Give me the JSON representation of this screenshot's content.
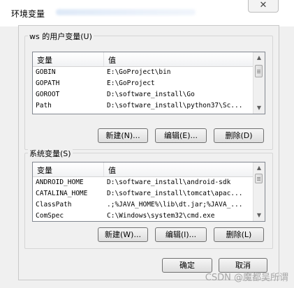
{
  "window": {
    "title": "环境变量",
    "close_label": "✕"
  },
  "user_vars": {
    "label": "ws 的用户变量(U)",
    "columns": [
      "变量",
      "值"
    ],
    "rows": [
      {
        "name": "GOBIN",
        "value": "E:\\GoProject\\bin"
      },
      {
        "name": "GOPATH",
        "value": "E:\\GoProject"
      },
      {
        "name": "GOROOT",
        "value": "D:\\software_install\\Go"
      },
      {
        "name": "Path",
        "value": "D:\\software_install\\python37\\Sc..."
      }
    ],
    "buttons": {
      "new": "新建(N)...",
      "edit": "编辑(E)...",
      "delete": "删除(D)"
    }
  },
  "system_vars": {
    "label": "系统变量(S)",
    "columns": [
      "变量",
      "值"
    ],
    "rows": [
      {
        "name": "ANDROID_HOME",
        "value": "D:\\software_install\\android-sdk"
      },
      {
        "name": "CATALINA_HOME",
        "value": "D:\\software_install\\tomcat\\apac..."
      },
      {
        "name": "ClassPath",
        "value": ".;%JAVA_HOME%\\lib\\dt.jar;%JAVA_..."
      },
      {
        "name": "ComSpec",
        "value": "C:\\Windows\\system32\\cmd.exe"
      }
    ],
    "buttons": {
      "new": "新建(W)...",
      "edit": "编辑(I)...",
      "delete": "删除(L)"
    }
  },
  "footer": {
    "ok": "确定",
    "cancel": "取消"
  },
  "watermark": "CSDN @魔都吴所谓"
}
